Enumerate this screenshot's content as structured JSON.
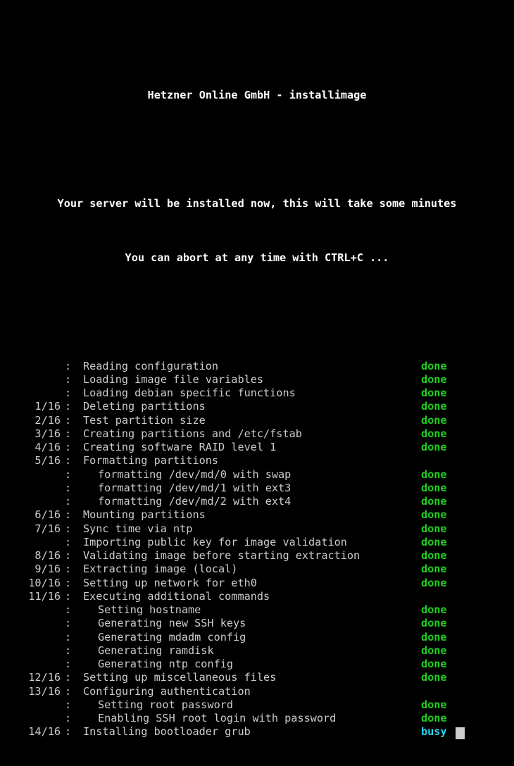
{
  "terminal": {
    "title": "Hetzner Online GmbH - installimage",
    "message_line1": "Your server will be installed now, this will take some minutes",
    "message_line2": "You can abort at any time with CTRL+C ...",
    "colon": ":",
    "colors": {
      "background": "#000000",
      "foreground": "#cccccc",
      "title": "#ffffff",
      "done": "#22cc22",
      "busy": "#22d3ee",
      "cursor": "#cccccc"
    },
    "status_done": "done",
    "status_busy": "busy",
    "total_steps": 16,
    "rows": [
      {
        "step": "",
        "text": "Reading configuration",
        "status": "done",
        "sub": false
      },
      {
        "step": "",
        "text": "Loading image file variables",
        "status": "done",
        "sub": false
      },
      {
        "step": "",
        "text": "Loading debian specific functions",
        "status": "done",
        "sub": false
      },
      {
        "step": "1/16",
        "text": "Deleting partitions",
        "status": "done",
        "sub": false
      },
      {
        "step": "2/16",
        "text": "Test partition size",
        "status": "done",
        "sub": false
      },
      {
        "step": "3/16",
        "text": "Creating partitions and /etc/fstab",
        "status": "done",
        "sub": false
      },
      {
        "step": "4/16",
        "text": "Creating software RAID level 1",
        "status": "done",
        "sub": false
      },
      {
        "step": "5/16",
        "text": "Formatting partitions",
        "status": "",
        "sub": false
      },
      {
        "step": "",
        "text": "formatting /dev/md/0 with swap",
        "status": "done",
        "sub": true
      },
      {
        "step": "",
        "text": "formatting /dev/md/1 with ext3",
        "status": "done",
        "sub": true
      },
      {
        "step": "",
        "text": "formatting /dev/md/2 with ext4",
        "status": "done",
        "sub": true
      },
      {
        "step": "6/16",
        "text": "Mounting partitions",
        "status": "done",
        "sub": false
      },
      {
        "step": "7/16",
        "text": "Sync time via ntp",
        "status": "done",
        "sub": false
      },
      {
        "step": "",
        "text": "Importing public key for image validation",
        "status": "done",
        "sub": false
      },
      {
        "step": "8/16",
        "text": "Validating image before starting extraction",
        "status": "done",
        "sub": false
      },
      {
        "step": "9/16",
        "text": "Extracting image (local)",
        "status": "done",
        "sub": false
      },
      {
        "step": "10/16",
        "text": "Setting up network for eth0",
        "status": "done",
        "sub": false
      },
      {
        "step": "11/16",
        "text": "Executing additional commands",
        "status": "",
        "sub": false
      },
      {
        "step": "",
        "text": "Setting hostname",
        "status": "done",
        "sub": true
      },
      {
        "step": "",
        "text": "Generating new SSH keys",
        "status": "done",
        "sub": true
      },
      {
        "step": "",
        "text": "Generating mdadm config",
        "status": "done",
        "sub": true
      },
      {
        "step": "",
        "text": "Generating ramdisk",
        "status": "done",
        "sub": true
      },
      {
        "step": "",
        "text": "Generating ntp config",
        "status": "done",
        "sub": true
      },
      {
        "step": "12/16",
        "text": "Setting up miscellaneous files",
        "status": "done",
        "sub": false
      },
      {
        "step": "13/16",
        "text": "Configuring authentication",
        "status": "",
        "sub": false
      },
      {
        "step": "",
        "text": "Setting root password",
        "status": "done",
        "sub": true
      },
      {
        "step": "",
        "text": "Enabling SSH root login with password",
        "status": "done",
        "sub": true
      },
      {
        "step": "14/16",
        "text": "Installing bootloader grub",
        "status": "busy",
        "sub": false
      }
    ]
  }
}
